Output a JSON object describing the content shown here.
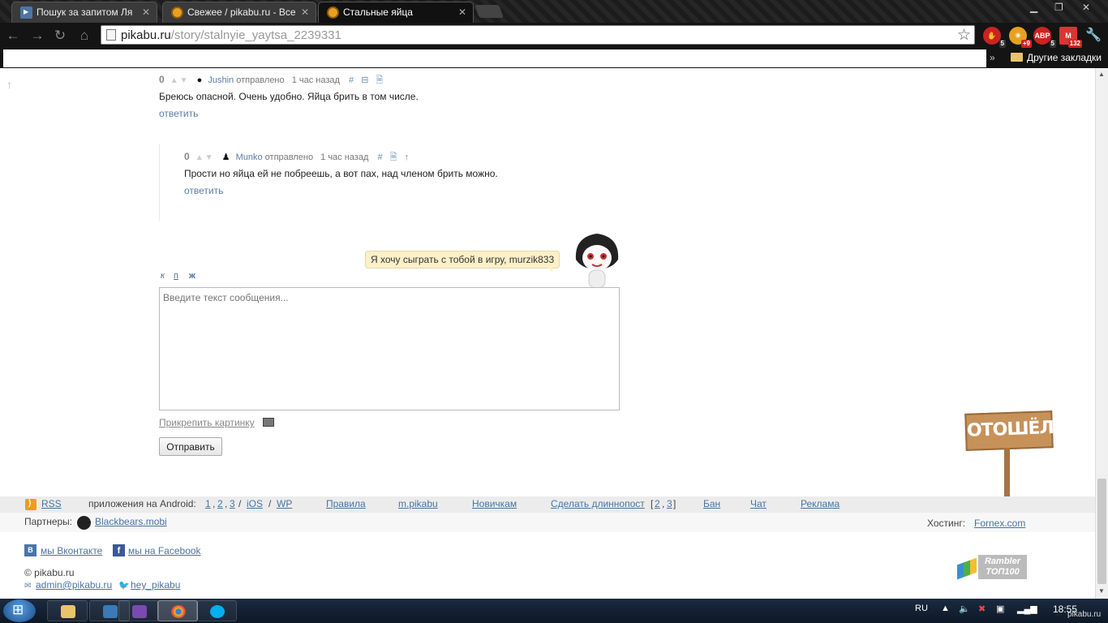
{
  "browser": {
    "tabs": [
      {
        "label": "Пошук за запитом Ля",
        "favicon": "vk-icon"
      },
      {
        "label": "Свежее / pikabu.ru - Все",
        "favicon": "pikabu-icon"
      },
      {
        "label": "Стальные яйца",
        "favicon": "pikabu-icon",
        "active": true
      }
    ],
    "url_domain": "pikabu.ru",
    "url_path": "/story/stalnyie_yaytsa_2239331",
    "extensions": [
      {
        "name": "adblock-icon",
        "badge": "5",
        "color": "#cc2222"
      },
      {
        "name": "weather-icon",
        "badge": "+9",
        "color": "#e8a020"
      },
      {
        "name": "abp-icon",
        "badge": "5",
        "color": "#cc2222",
        "text": "ABP"
      },
      {
        "name": "gmail-icon",
        "badge": "132",
        "color": "#dd3333"
      }
    ],
    "other_bookmarks": "Другие закладки",
    "bookmarks_chevron": "»"
  },
  "comments": [
    {
      "score": "0",
      "user": "Jushin",
      "posted": "отправлено",
      "time": "1 час назад",
      "actions": [
        "#",
        "⊟",
        "🗎"
      ],
      "text": "Бреюсь опасной. Очень удобно. Яйца брить в том числе.",
      "reply": "ответить"
    },
    {
      "score": "0",
      "user": "Munko",
      "posted": "отправлено",
      "time": "1 час назад",
      "actions": [
        "#",
        "🗎",
        "↑"
      ],
      "text": "Прости но яйца ей не побреешь, а вот пах, над членом брить можно.",
      "reply": "ответить"
    }
  ],
  "reply_form": {
    "bubble": "Я хочу сыграть с тобой в игру, murzik833",
    "format": [
      "к",
      "п",
      "ж"
    ],
    "placeholder": "Введите текст сообщения...",
    "attach": "Прикрепить картинку",
    "submit": "Отправить"
  },
  "sign_text": "ОТОШЁЛ",
  "footer": {
    "rss": "RSS",
    "android_label": "приложения на Android:",
    "android_links": [
      "1",
      "2",
      "3"
    ],
    "ios": "iOS",
    "wp": "WP",
    "sep": "/",
    "rules": "Правила",
    "mobile": "m.pikabu",
    "newbies": "Новичкам",
    "long": "Сделать длиннопост",
    "long_links": [
      "2",
      "3"
    ],
    "ban": "Бан",
    "chat": "Чат",
    "ads": "Реклама",
    "partners_label": "Партнеры:",
    "partner": "Blackbears.mobi",
    "hosting_label": "Хостинг:",
    "hosting": "Fornex.com",
    "vk": "мы Вконтакте",
    "fb": "мы на Facebook",
    "copyright": "© pikabu.ru",
    "email": "admin@pikabu.ru",
    "twitter": "hey_pikabu",
    "rambler_top": "Rambler",
    "rambler_bottom": "ТОП100"
  },
  "taskbar": {
    "lang": "RU",
    "clock": "18:55",
    "watermark": "pikabu.ru"
  }
}
